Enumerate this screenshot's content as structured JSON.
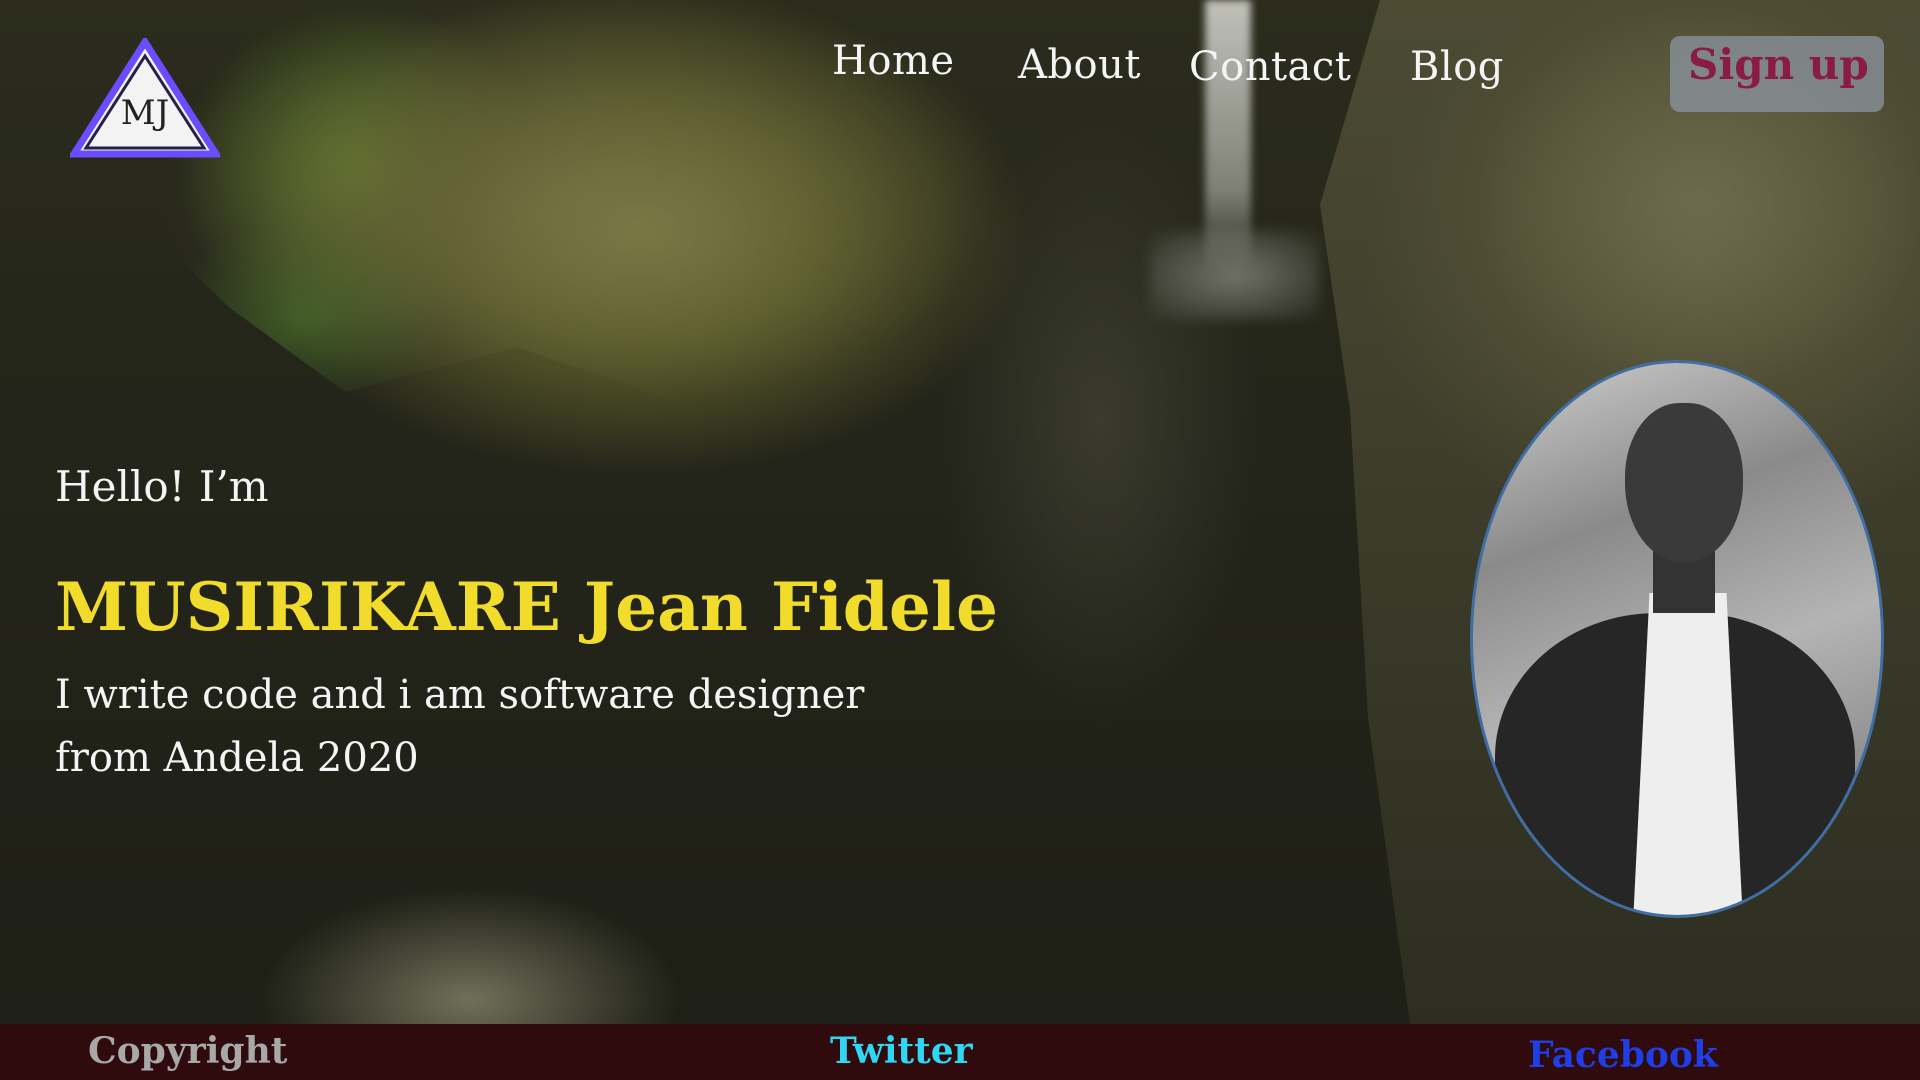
{
  "brand": {
    "logo_text": "MJ"
  },
  "nav": {
    "items": [
      {
        "label": "Home"
      },
      {
        "label": "About"
      },
      {
        "label": "Contact"
      },
      {
        "label": "Blog"
      }
    ],
    "signup_label": "Sign up"
  },
  "hero": {
    "greeting": "Hello! I’m",
    "name": "MUSIRIKARE Jean Fidele",
    "tagline_line1": "I write code and i am software designer",
    "tagline_line2": "from Andela 2020"
  },
  "footer": {
    "copyright_label": "Copyright",
    "twitter_label": "Twitter",
    "facebook_label": "Facebook"
  },
  "colors": {
    "name_yellow": "#f1dc2c",
    "signup_text": "#8a1b42",
    "footer_bg": "#2f0b0e",
    "twitter_cyan": "#2fd7f2",
    "facebook_blue": "#1f3ee6",
    "copyright_gray": "#a8a8a8",
    "logo_stroke": "#6c4cff"
  }
}
